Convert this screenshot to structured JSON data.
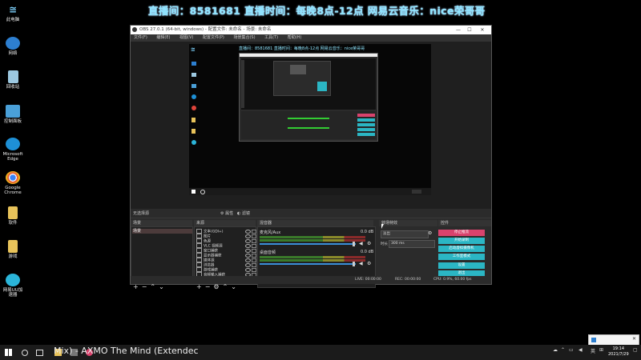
{
  "banner": "直播间：8581681  直播时间：每晚8点-12点  网易云音乐：nice荣哥哥",
  "desktop_icons": [
    {
      "label": "此电脑",
      "icon": "computer-icon",
      "color": "#2a6fb3"
    },
    {
      "label": "网络",
      "icon": "network-icon",
      "color": "#2d7fd0"
    },
    {
      "label": "回收站",
      "icon": "recycle-bin-icon",
      "color": "#9cc8e0"
    },
    {
      "label": "控制面板",
      "icon": "control-panel-icon",
      "color": "#4aa0d8"
    },
    {
      "label": "Microsoft Edge",
      "icon": "edge-icon",
      "color": "#1e90d6"
    },
    {
      "label": "Google Chrome",
      "icon": "chrome-icon",
      "color": "#e0443a"
    },
    {
      "label": "软件",
      "icon": "folder-icon",
      "color": "#e8c35a"
    },
    {
      "label": "游戏",
      "icon": "folder-icon",
      "color": "#e8c35a"
    },
    {
      "label": "网易UU加速器",
      "icon": "uu-booster-icon",
      "color": "#2bb5d9"
    }
  ],
  "obs": {
    "title": "OBS 27.0.1 (64-bit, windows) - 配置文件: 未命名 - 场景: 未命名",
    "menu": [
      "文件(F)",
      "编辑(E)",
      "视图(V)",
      "配置文件(P)",
      "场景集合(S)",
      "工具(T)",
      "帮助(H)"
    ],
    "filter_bar": {
      "label": "无选择源",
      "properties": "属性",
      "filters": "滤镜"
    },
    "docks": {
      "scenes": "场景",
      "sources": "来源",
      "mixer": "混音器",
      "transitions": "转场特效",
      "controls": "控件"
    },
    "scenes": [
      "场景"
    ],
    "sources": [
      "文本(GDI+)",
      "图片",
      "色源",
      "VLC 视频源",
      "窗口捕获",
      "显示器捕获",
      "媒体源",
      "浏览器",
      "游戏捕获",
      "音频输入捕获",
      "音频输出捕获",
      "图像幻灯片"
    ],
    "mixer": [
      {
        "name": "麦克风/Aux",
        "db": "0.0 dB",
        "level": 0.62
      },
      {
        "name": "桌面音频",
        "db": "0.0 dB",
        "level": 0.62
      }
    ],
    "transitions": {
      "type": "淡出",
      "duration_label": "时长",
      "duration": "300 ms"
    },
    "controls": [
      "停止推流",
      "开始录制",
      "启动虚拟摄像机",
      "工作室模式",
      "设置",
      "退出"
    ],
    "status": {
      "live": "LIVE: 00:00:00",
      "rec": "REC: 00:00:00",
      "cpu": "CPU: 0.9%, 60.00 fps"
    }
  },
  "taskbar": {
    "now_playing": "Mix) - AXMO  The Mind (Extendec",
    "time": "19:14",
    "date": "2021/7/29",
    "lang": "英"
  }
}
